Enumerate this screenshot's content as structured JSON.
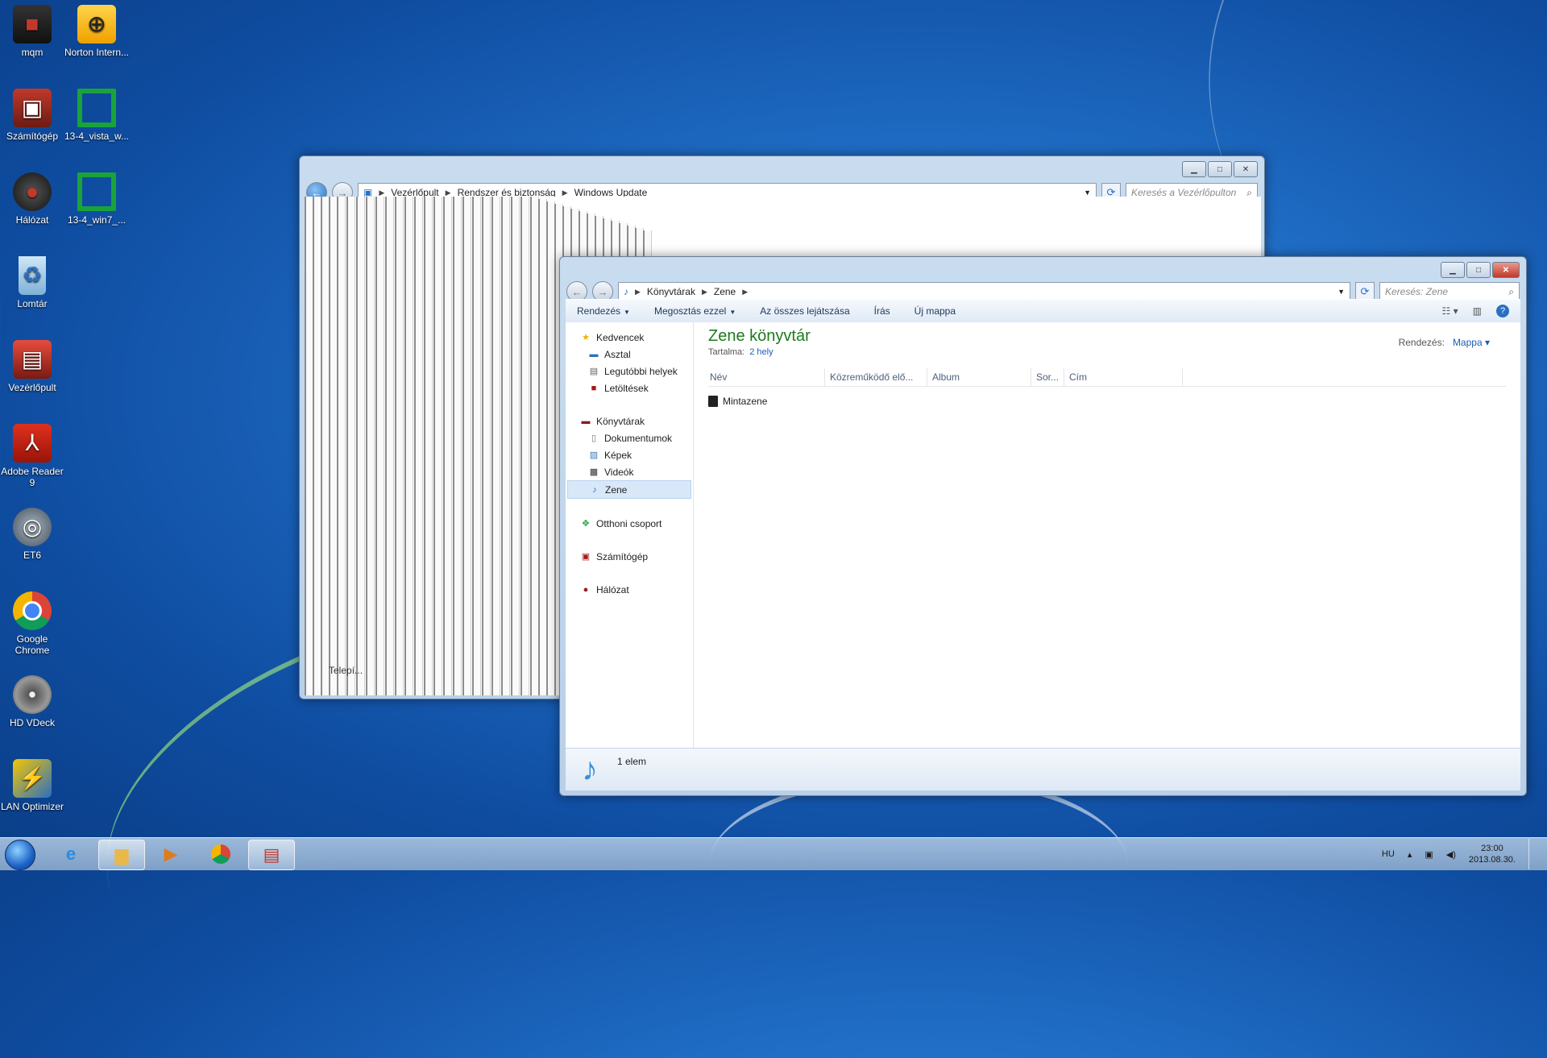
{
  "desktop": {
    "icons": [
      {
        "label": "mqm",
        "icon": "computer-red-icon"
      },
      {
        "label": "Norton Intern...",
        "icon": "globe-icon"
      },
      {
        "label": "Számítógép",
        "icon": "computer-icon"
      },
      {
        "label": "13-4_vista_w...",
        "icon": "green-shortcut-icon"
      },
      {
        "label": "Hálózat",
        "icon": "network-icon"
      },
      {
        "label": "13-4_win7_...",
        "icon": "green-shortcut-icon"
      },
      {
        "label": "Lomtár",
        "icon": "recycle-bin-icon"
      },
      {
        "label": "Vezérlőpult",
        "icon": "control-panel-icon"
      },
      {
        "label": "Adobe Reader 9",
        "icon": "pdf-icon"
      },
      {
        "label": "ET6",
        "icon": "steering-wheel-icon"
      },
      {
        "label": "Google Chrome",
        "icon": "chrome-icon"
      },
      {
        "label": "HD VDeck",
        "icon": "disc-icon"
      },
      {
        "label": "LAN Optimizer",
        "icon": "lan-optimizer-icon"
      }
    ]
  },
  "control_panel": {
    "address": [
      "Vezérlőpult",
      "Rendszer és biztonság",
      "Windows Update"
    ],
    "search_placeholder": "Keresés a Vezérlőpulton",
    "glitch_text": "Telepí..."
  },
  "explorer": {
    "address": [
      "Könyvtárak",
      "Zene"
    ],
    "search_placeholder": "Keresés: Zene",
    "toolbar": {
      "organize": "Rendezés",
      "share": "Megosztás ezzel",
      "play_all": "Az összes lejátszása",
      "burn": "Írás",
      "new_folder": "Új mappa"
    },
    "nav": {
      "favorites": "Kedvencek",
      "desktop": "Asztal",
      "recent": "Legutóbbi helyek",
      "downloads": "Letöltések",
      "libraries": "Könyvtárak",
      "documents": "Dokumentumok",
      "pictures": "Képek",
      "videos": "Videók",
      "music": "Zene",
      "homegroup": "Otthoni csoport",
      "computer": "Számítógép",
      "network": "Hálózat"
    },
    "content": {
      "title": "Zene könyvtár",
      "includes_label": "Tartalma:",
      "includes_value": "2 hely",
      "arrange_label": "Rendezés:",
      "arrange_value": "Mappa",
      "columns": [
        "Név",
        "Közreműködő elő...",
        "Album",
        "Sor...",
        "Cím"
      ],
      "items": [
        {
          "name": "Mintazene"
        }
      ]
    },
    "details": "1 elem"
  },
  "taskbar": {
    "lang": "HU",
    "time": "23:00",
    "date": "2013.08.30."
  },
  "colors": {
    "library_title": "#1e7a1e",
    "link": "#1a5fb4",
    "desktop_bg": "#1f6cc4"
  }
}
